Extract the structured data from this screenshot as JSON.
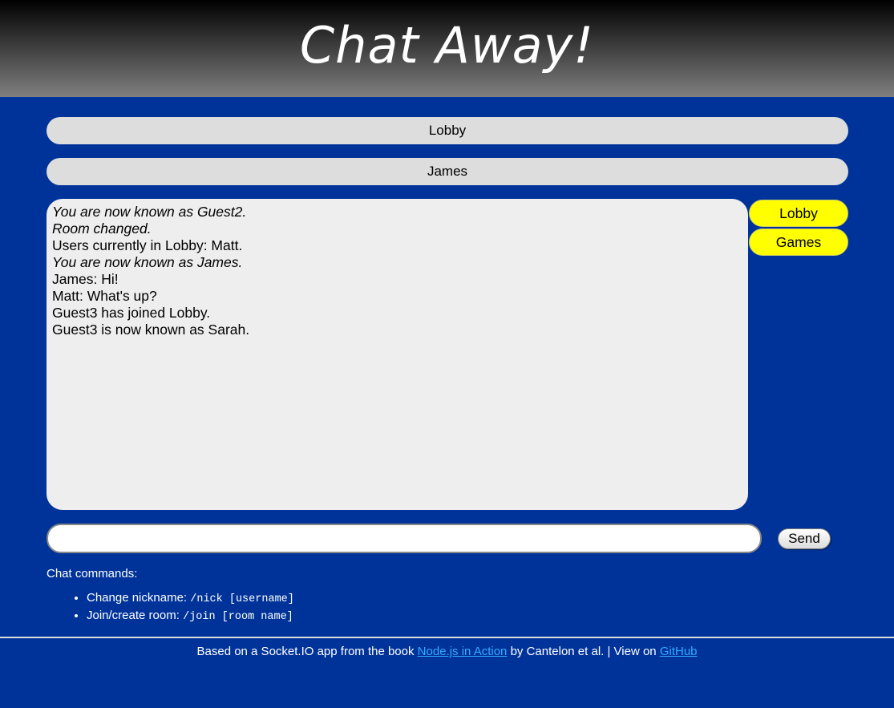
{
  "header": {
    "title": "Chat Away!"
  },
  "room_bar": {
    "label": "Lobby"
  },
  "nick_bar": {
    "label": "James"
  },
  "messages": [
    {
      "text": "You are now known as Guest2.",
      "system": true
    },
    {
      "text": "Room changed.",
      "system": true
    },
    {
      "text": "Users currently in Lobby: Matt.",
      "system": false
    },
    {
      "text": "You are now known as James.",
      "system": true
    },
    {
      "text": "James: Hi!",
      "system": false
    },
    {
      "text": "Matt: What's up?",
      "system": false
    },
    {
      "text": "Guest3 has joined Lobby.",
      "system": false
    },
    {
      "text": "Guest3 is now known as Sarah.",
      "system": false
    }
  ],
  "rooms": [
    {
      "label": "Lobby"
    },
    {
      "label": "Games"
    }
  ],
  "input": {
    "value": "",
    "placeholder": ""
  },
  "send_button": {
    "label": "Send"
  },
  "help": {
    "title": "Chat commands:",
    "commands": [
      {
        "label": "Change nickname: ",
        "code": "/nick [username]"
      },
      {
        "label": "Join/create room: ",
        "code": "/join [room name]"
      }
    ]
  },
  "footer": {
    "prefix": "Based on a Socket.IO app from the book ",
    "book_link": "Node.js in Action",
    "middle": " by Cantelon et al. | View on ",
    "github_link": "GitHub"
  },
  "colors": {
    "background": "#003399",
    "room_button": "#ffff00",
    "link": "#33aaff"
  }
}
